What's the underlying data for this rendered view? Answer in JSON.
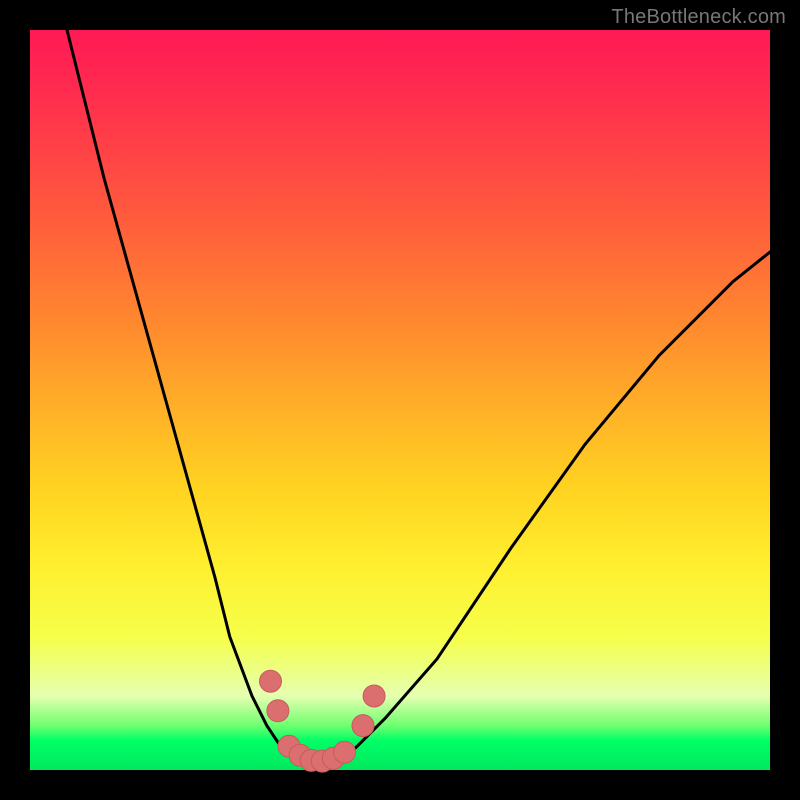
{
  "watermark": "TheBottleneck.com",
  "chart_data": {
    "type": "line",
    "title": "",
    "xlabel": "",
    "ylabel": "",
    "xlim": [
      0,
      100
    ],
    "ylim": [
      0,
      100
    ],
    "series": [
      {
        "name": "bottleneck-curve",
        "x": [
          5,
          10,
          15,
          20,
          25,
          27,
          30,
          32,
          34,
          36,
          37,
          38,
          40,
          42,
          44,
          48,
          55,
          65,
          75,
          85,
          95,
          100
        ],
        "y": [
          100,
          80,
          62,
          44,
          26,
          18,
          10,
          6,
          3,
          1.5,
          1,
          1,
          1.2,
          1.8,
          3,
          7,
          15,
          30,
          44,
          56,
          66,
          70
        ]
      }
    ],
    "markers": [
      {
        "name": "marker-left-upper",
        "x": 32.5,
        "y": 12
      },
      {
        "name": "marker-left-lower",
        "x": 33.5,
        "y": 8
      },
      {
        "name": "marker-valley-1",
        "x": 35,
        "y": 3.2
      },
      {
        "name": "marker-valley-2",
        "x": 36.5,
        "y": 2.0
      },
      {
        "name": "marker-valley-3",
        "x": 38,
        "y": 1.3
      },
      {
        "name": "marker-valley-4",
        "x": 39.5,
        "y": 1.2
      },
      {
        "name": "marker-valley-5",
        "x": 41,
        "y": 1.6
      },
      {
        "name": "marker-valley-6",
        "x": 42.5,
        "y": 2.4
      },
      {
        "name": "marker-right-lower",
        "x": 45,
        "y": 6
      },
      {
        "name": "marker-right-upper",
        "x": 46.5,
        "y": 10
      }
    ],
    "colors": {
      "curve": "#000000",
      "marker_fill": "#db6f6f",
      "marker_stroke": "#c85a5a",
      "gradient_top": "#ff1a55",
      "gradient_bottom": "#00e85e"
    }
  }
}
